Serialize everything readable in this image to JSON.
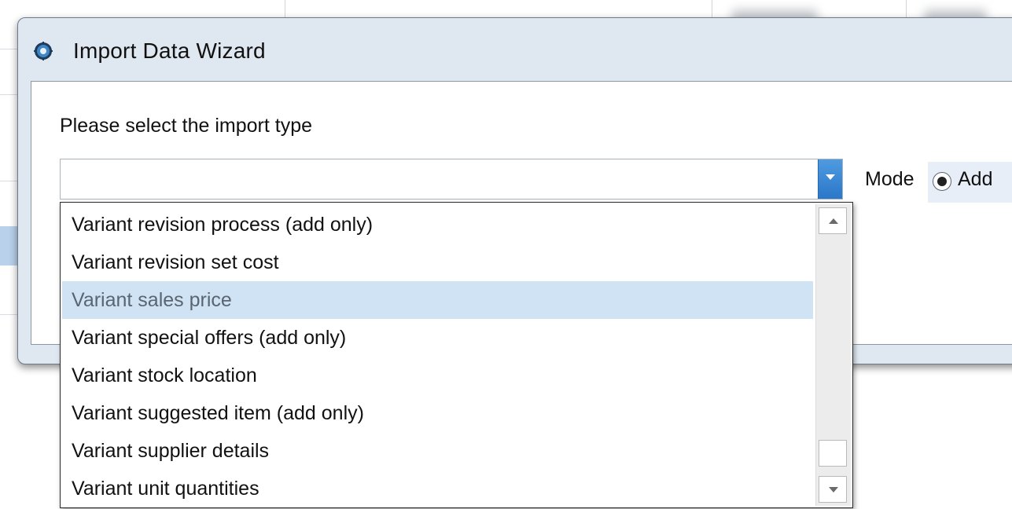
{
  "window": {
    "title": "Import Data Wizard",
    "icon": "gear-icon"
  },
  "form": {
    "prompt": "Please select the import type",
    "import_type_value": "",
    "mode_label": "Mode",
    "mode_option": "Add"
  },
  "dropdown": {
    "items": [
      {
        "label": "Variant revision process (add only)",
        "selected": false
      },
      {
        "label": "Variant revision set cost",
        "selected": false
      },
      {
        "label": "Variant sales price",
        "selected": true
      },
      {
        "label": "Variant special offers (add only)",
        "selected": false
      },
      {
        "label": "Variant stock location",
        "selected": false
      },
      {
        "label": "Variant suggested item (add only)",
        "selected": false
      },
      {
        "label": "Variant supplier details",
        "selected": false
      },
      {
        "label": "Variant unit quantities",
        "selected": false
      }
    ]
  },
  "colors": {
    "selection": "#cfe3f5",
    "combo_button": "#2b77c9"
  }
}
